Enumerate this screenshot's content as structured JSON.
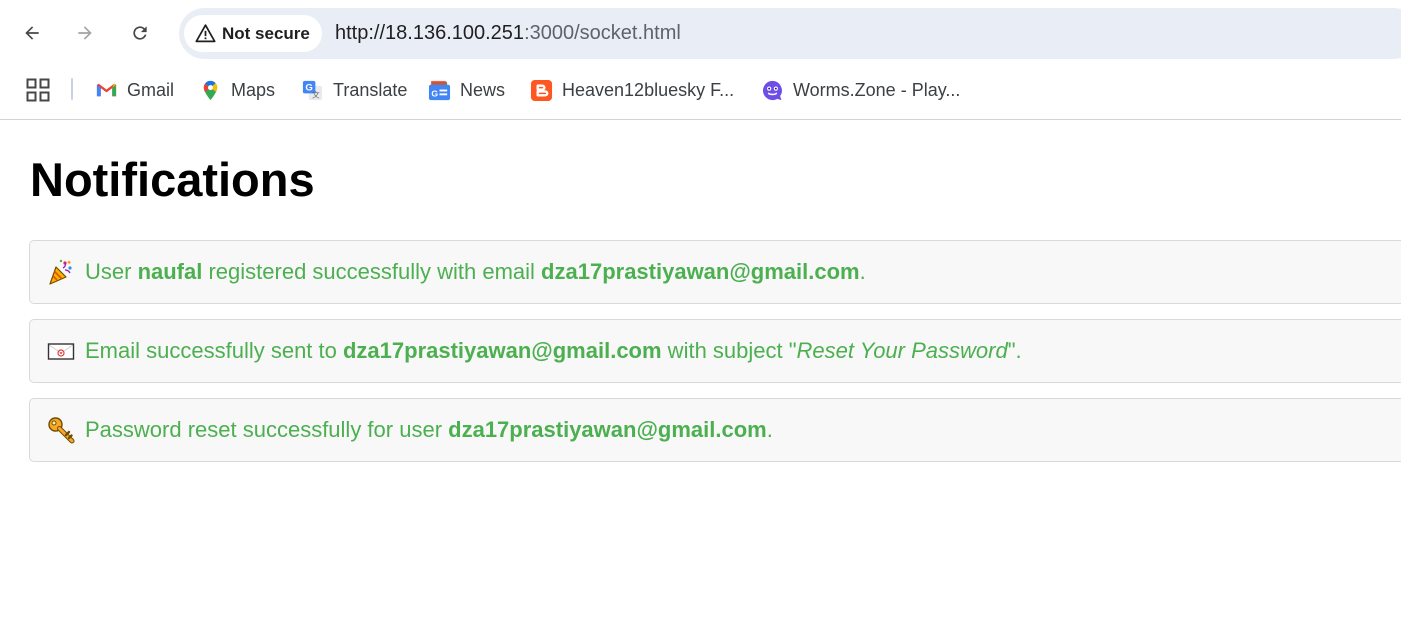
{
  "browser": {
    "security_label": "Not secure",
    "url_host": "http://18.136.100.251",
    "url_rest": ":3000/socket.html",
    "bookmarks": [
      {
        "label": "Gmail",
        "icon": "gmail-icon"
      },
      {
        "label": "Maps",
        "icon": "maps-icon"
      },
      {
        "label": "Translate",
        "icon": "translate-icon"
      },
      {
        "label": "News",
        "icon": "news-icon"
      },
      {
        "label": "Heaven12bluesky F...",
        "icon": "blogger-icon"
      },
      {
        "label": "Worms.Zone - Play...",
        "icon": "worms-zone-icon"
      }
    ]
  },
  "page": {
    "title": "Notifications",
    "notifications": [
      {
        "icon": "party-popper-icon",
        "prefix": "User ",
        "user": "naufal",
        "middle": " registered successfully with email ",
        "email": "dza17prastiyawan@gmail.com",
        "suffix": "."
      },
      {
        "icon": "envelope-icon",
        "prefix": "Email successfully sent to ",
        "email": "dza17prastiyawan@gmail.com",
        "middle": " with subject \"",
        "subject": "Reset Your Password",
        "suffix": "\"."
      },
      {
        "icon": "key-icon",
        "prefix": "Password reset successfully for user ",
        "email": "dza17prastiyawan@gmail.com",
        "suffix": "."
      }
    ]
  },
  "colors": {
    "notification_text": "#4caf50",
    "notification_bg": "#f8f8f8",
    "omnibox_bg": "#e9eef6"
  }
}
